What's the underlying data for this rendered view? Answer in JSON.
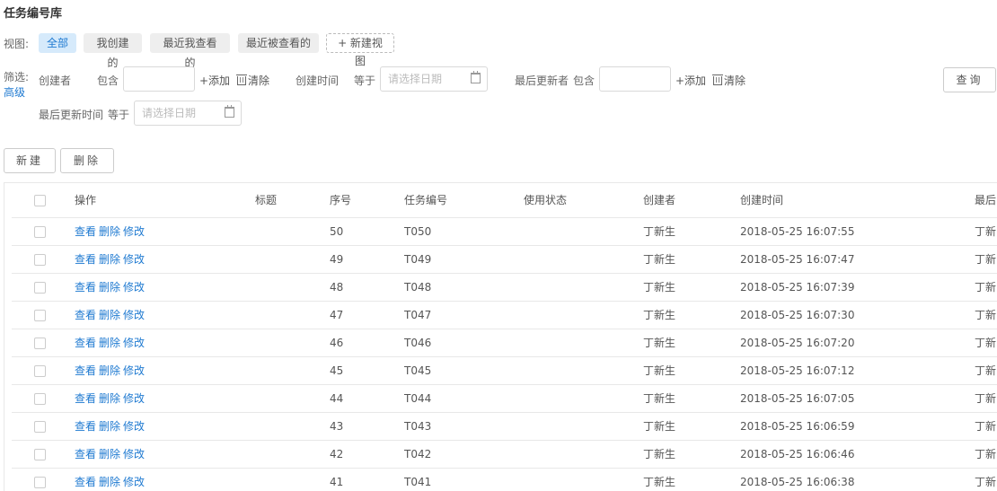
{
  "page": {
    "title": "任务编号库"
  },
  "views": {
    "label": "视图:",
    "items": [
      "全部",
      "我创建的",
      "最近我查看的",
      "最近被查看的"
    ],
    "active_index": 0,
    "new_view": "+ 新建视图"
  },
  "filter": {
    "label": "筛选:",
    "advanced": "高级",
    "creator": {
      "label": "创建者",
      "op": "包含",
      "value": "",
      "add": "+添加",
      "clear": "清除"
    },
    "created_time": {
      "label": "创建时间",
      "op": "等于",
      "placeholder": "请选择日期"
    },
    "last_updater": {
      "label": "最后更新者",
      "op": "包含",
      "value": "",
      "add": "+添加",
      "clear": "清除"
    },
    "last_updated_time": {
      "label": "最后更新时间",
      "op": "等于",
      "placeholder": "请选择日期"
    },
    "query_button": "查询"
  },
  "toolbar": {
    "new_button": "新建",
    "delete_button": "删除"
  },
  "table": {
    "columns": [
      "操作",
      "标题",
      "序号",
      "任务编号",
      "使用状态",
      "创建者",
      "创建时间",
      "最后"
    ],
    "actions": [
      "查看",
      "删除",
      "修改"
    ],
    "rows": [
      {
        "title": "",
        "seq": "50",
        "code": "T050",
        "status": "",
        "creator": "丁新生",
        "created": "2018-05-25 16:07:55",
        "last": "丁新"
      },
      {
        "title": "",
        "seq": "49",
        "code": "T049",
        "status": "",
        "creator": "丁新生",
        "created": "2018-05-25 16:07:47",
        "last": "丁新"
      },
      {
        "title": "",
        "seq": "48",
        "code": "T048",
        "status": "",
        "creator": "丁新生",
        "created": "2018-05-25 16:07:39",
        "last": "丁新"
      },
      {
        "title": "",
        "seq": "47",
        "code": "T047",
        "status": "",
        "creator": "丁新生",
        "created": "2018-05-25 16:07:30",
        "last": "丁新"
      },
      {
        "title": "",
        "seq": "46",
        "code": "T046",
        "status": "",
        "creator": "丁新生",
        "created": "2018-05-25 16:07:20",
        "last": "丁新"
      },
      {
        "title": "",
        "seq": "45",
        "code": "T045",
        "status": "",
        "creator": "丁新生",
        "created": "2018-05-25 16:07:12",
        "last": "丁新"
      },
      {
        "title": "",
        "seq": "44",
        "code": "T044",
        "status": "",
        "creator": "丁新生",
        "created": "2018-05-25 16:07:05",
        "last": "丁新"
      },
      {
        "title": "",
        "seq": "43",
        "code": "T043",
        "status": "",
        "creator": "丁新生",
        "created": "2018-05-25 16:06:59",
        "last": "丁新"
      },
      {
        "title": "",
        "seq": "42",
        "code": "T042",
        "status": "",
        "creator": "丁新生",
        "created": "2018-05-25 16:06:46",
        "last": "丁新"
      },
      {
        "title": "",
        "seq": "41",
        "code": "T041",
        "status": "",
        "creator": "丁新生",
        "created": "2018-05-25 16:06:38",
        "last": "丁新"
      }
    ]
  },
  "colors": {
    "accent": "#1f7ad1",
    "active_pill_bg": "#d6eafb",
    "border": "#e8e8e8"
  },
  "icons": {
    "calendar": "calendar-icon",
    "trash": "trash-icon",
    "checkbox": "checkbox"
  }
}
